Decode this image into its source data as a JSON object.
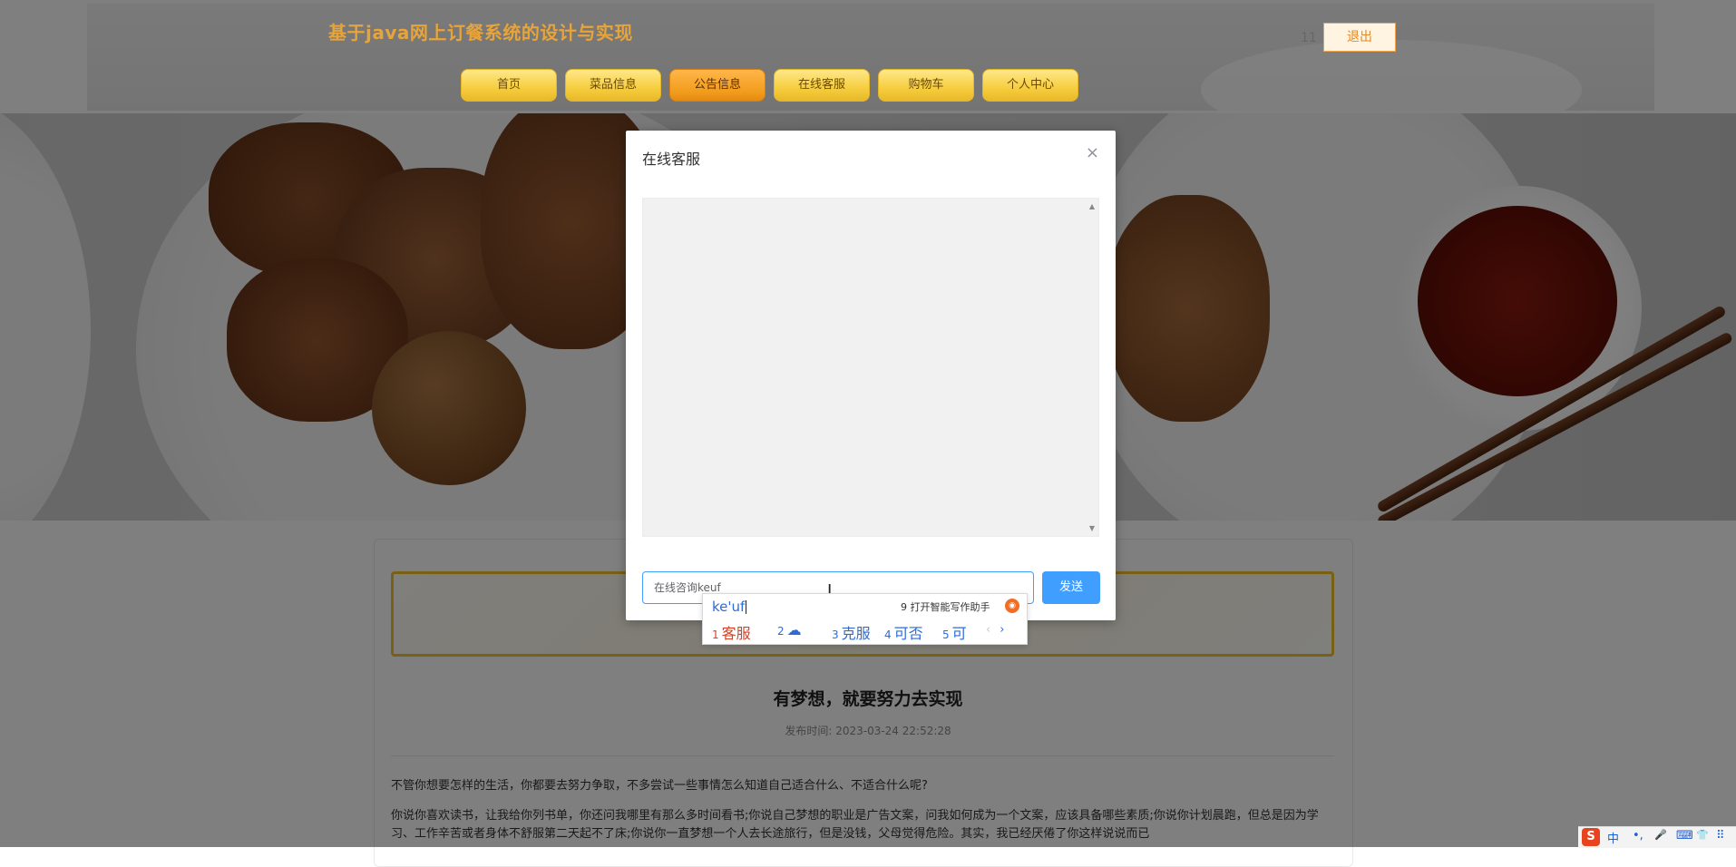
{
  "site": {
    "title": "基于java网上订餐系统的设计与实现",
    "username": "11",
    "logout_label": "退出"
  },
  "nav": {
    "items": [
      {
        "label": "首页"
      },
      {
        "label": "菜品信息"
      },
      {
        "label": "公告信息"
      },
      {
        "label": "在线客服"
      },
      {
        "label": "购物车"
      },
      {
        "label": "个人中心"
      }
    ],
    "active": "公告信息"
  },
  "article": {
    "title": "有梦想，就要努力去实现",
    "publish_time": "发布时间: 2023-03-24 22:52:28",
    "paragraphs": [
      "不管你想要怎样的生活，你都要去努力争取，不多尝试一些事情怎么知道自己适合什么、不适合什么呢?",
      "你说你喜欢读书，让我给你列书单，你还问我哪里有那么多时间看书;你说自己梦想的职业是广告文案，问我如何成为一个文案，应该具备哪些素质;你说你计划晨跑，但总是因为学习、工作辛苦或者身体不舒服第二天起不了床;你说你一直梦想一个人去长途旅行，但是没钱，父母觉得危险。其实，我已经厌倦了你这样说说而已"
    ]
  },
  "modal": {
    "title": "在线客服",
    "close_icon": "×",
    "input_value": "在线咨询keuf",
    "send_label": "发送"
  },
  "ime": {
    "pinyin": "ke'uf",
    "hint": "9 打开智能写作助手",
    "candidates": [
      {
        "num": "1",
        "text": "客服"
      },
      {
        "num": "2",
        "text": "☁"
      },
      {
        "num": "3",
        "text": "克服"
      },
      {
        "num": "4",
        "text": "可否"
      },
      {
        "num": "5",
        "text": "可"
      }
    ],
    "prev": "‹",
    "next": "›"
  },
  "tray": {
    "logo": "S",
    "items": [
      "中",
      "•,",
      "🎤",
      "⌨",
      "👕",
      "⠿"
    ]
  }
}
